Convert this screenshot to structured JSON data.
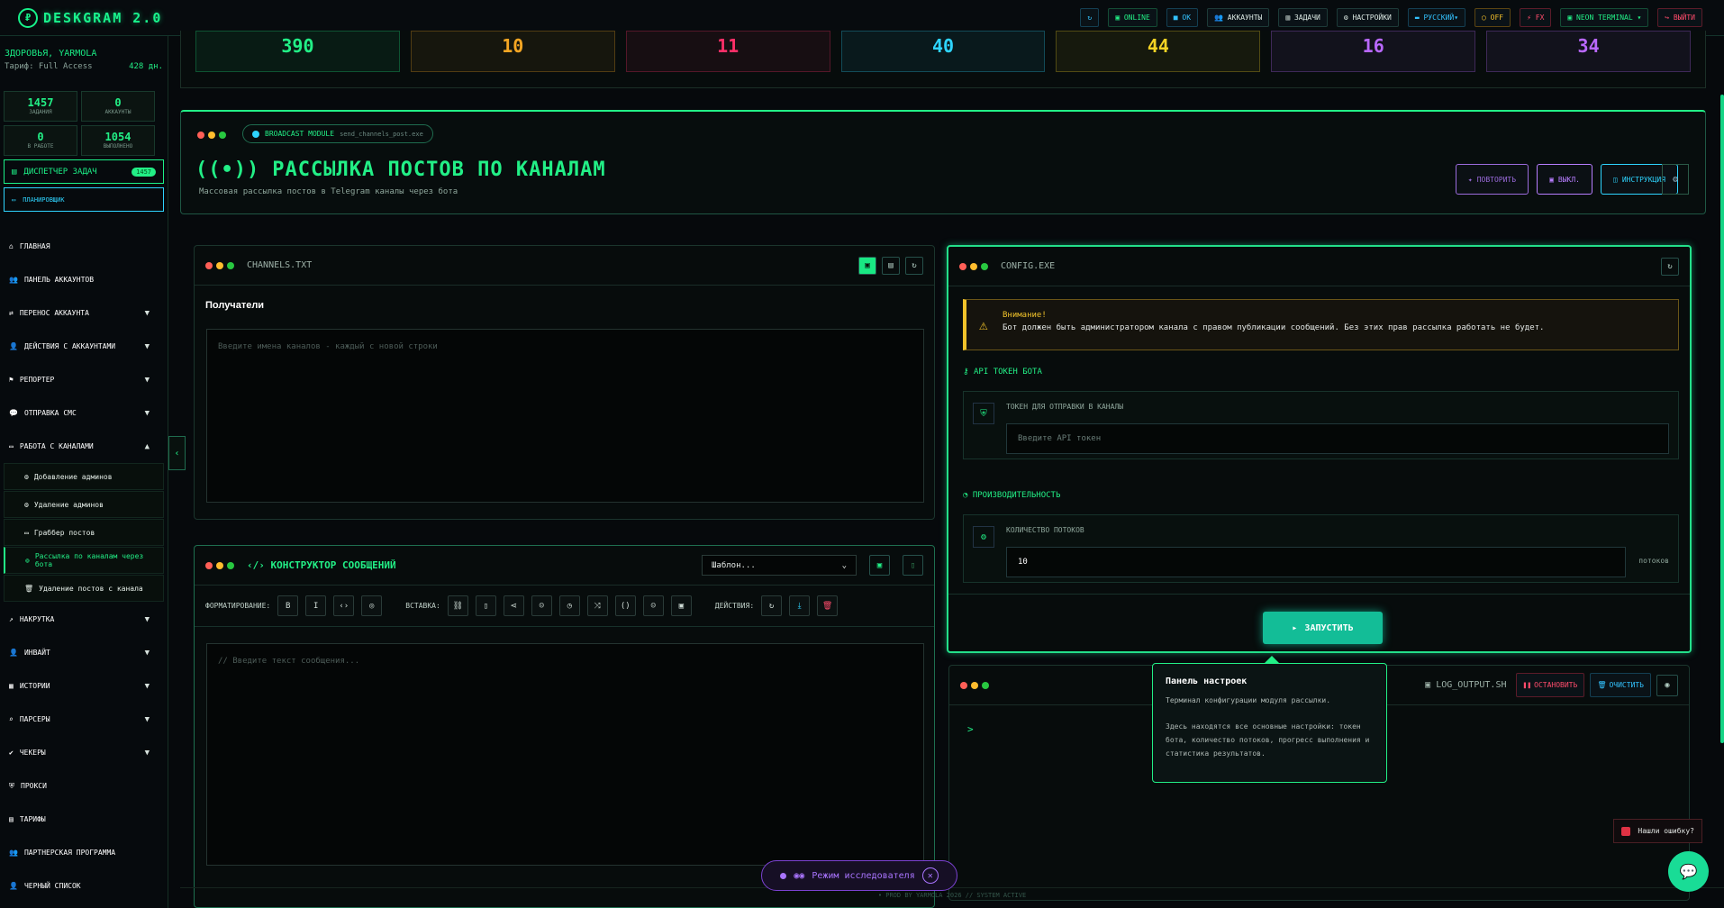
{
  "header": {
    "logo_badge": "₽",
    "title": "DESKGRAM 2.0",
    "buttons": [
      {
        "label": "↻",
        "color": "b"
      },
      {
        "label": "▣ ONLINE",
        "color": "g"
      },
      {
        "label": "■ OK",
        "color": "b"
      },
      {
        "label": "👥 АККАУНТЫ"
      },
      {
        "label": "▥ ЗАДАЧИ"
      },
      {
        "label": "⚙ НАСТРОЙКИ"
      },
      {
        "label": "▬ РУССКИЙ▾",
        "color": "b"
      },
      {
        "label": "◯ OFF",
        "color": "y"
      },
      {
        "label": "⚡ FX",
        "color": "r"
      },
      {
        "label": "▣ NEON TERMINAL ▾",
        "color": "g"
      },
      {
        "label": "↪ ВЫЙТИ",
        "color": "r"
      }
    ]
  },
  "sidebar": {
    "user": "ЗДОРОВЬЯ, YARMOLA",
    "plan": "Тариф: Full Access",
    "days": "428 дн.",
    "stats": [
      {
        "value": "1457",
        "label": "ЗАДАНИЯ"
      },
      {
        "value": "0",
        "label": "АККАУНТЫ"
      },
      {
        "value": "0",
        "label": "В РАБОТЕ"
      },
      {
        "value": "1054",
        "label": "ВЫПОЛНЕНО"
      }
    ],
    "dispatcher": "ДИСПЕТЧЕР ЗАДАЧ",
    "dispatcher_badge": "1457",
    "scheduler": "ПЛАНИРОВЩИК",
    "menu": [
      {
        "label": "ГЛАВНАЯ",
        "icon": "⌂"
      },
      {
        "label": "ПАНЕЛЬ АККАУНТОВ",
        "icon": "👥"
      },
      {
        "label": "ПЕРЕНОС АККАУНТА",
        "icon": "⇄",
        "ch": "▼"
      },
      {
        "label": "ДЕЙСТВИЯ С АККАУНТАМИ",
        "icon": "👤",
        "ch": "▼"
      },
      {
        "label": "РЕПОРТЕР",
        "icon": "⚑",
        "ch": "▼"
      },
      {
        "label": "ОТПРАВКА СМС",
        "icon": "💬",
        "ch": "▼"
      },
      {
        "label": "РАБОТА С КАНАЛАМИ",
        "icon": "▭",
        "ch": "▲"
      }
    ],
    "submenu": [
      {
        "label": "Добавление админов",
        "icon": "⚙"
      },
      {
        "label": "Удаление админов",
        "icon": "⚙"
      },
      {
        "label": "Граббер постов",
        "icon": "▭"
      },
      {
        "label": "Рассылка по каналам через бота",
        "icon": "⊚",
        "active": true
      },
      {
        "label": "Удаление постов с канала",
        "icon": "🗑"
      }
    ],
    "menu2": [
      {
        "label": "НАКРУТКА",
        "icon": "↗",
        "ch": "▼"
      },
      {
        "label": "ИНВАЙТ",
        "icon": "👤",
        "ch": "▼"
      },
      {
        "label": "ИСТОРИИ",
        "icon": "▦",
        "ch": "▼"
      },
      {
        "label": "ПАРСЕРЫ",
        "icon": "⌕",
        "ch": "▼"
      },
      {
        "label": "ЧЕКЕРЫ",
        "icon": "✔",
        "ch": "▼"
      },
      {
        "label": "ПРОКСИ",
        "icon": "⛨"
      },
      {
        "label": "ТАРИФЫ",
        "icon": "▤"
      },
      {
        "label": "ПАРТНЕРСКАЯ ПРОГРАММА",
        "icon": "👥"
      },
      {
        "label": "ЧЕРНЫЙ СПИСОК",
        "icon": "👤"
      }
    ]
  },
  "metrics": [
    {
      "value": "390",
      "color": "#22ef86"
    },
    {
      "value": "10",
      "color": "#f5a623"
    },
    {
      "value": "11",
      "color": "#ff2f68"
    },
    {
      "value": "40",
      "color": "#2ed4ff"
    },
    {
      "value": "44",
      "color": "#f4d324"
    },
    {
      "value": "16",
      "color": "#b968ff"
    },
    {
      "value": "34",
      "color": "#b968ff"
    }
  ],
  "hero": {
    "module": "BROADCAST MODULE",
    "file": "send_channels_post.exe",
    "title": "РАССЫЛКА ПОСТОВ ПО КАНАЛАМ",
    "subtitle": "Массовая рассылка постов в Telegram каналы через бота",
    "buttons": [
      {
        "label": "ПОВТОРИТЬ",
        "color": "#9b6bdc"
      },
      {
        "label": "ВЫКЛ.",
        "color": "#b77dff"
      },
      {
        "label": "ИНСТРУКЦИЯ",
        "color": "#2ed4ff"
      }
    ]
  },
  "channels": {
    "file": "CHANNELS.TXT",
    "label": "Получатели",
    "placeholder": "Введите имена каналов - каждый с новой строки"
  },
  "constructor": {
    "title": "КОНСТРУКТОР СООБЩЕНИЙ",
    "template": "Шаблон...",
    "format_label": "ФОРМАТИРОВАНИЕ:",
    "insert_label": "ВСТАВКА:",
    "actions_label": "ДЕЙСТВИЯ:",
    "placeholder": "// Введите текст сообщения..."
  },
  "config": {
    "file": "CONFIG.EXE",
    "warn_title": "Внимание!",
    "warn_text": "Бот должен быть администратором канала с правом публикации сообщений. Без этих прав рассылка работать не будет.",
    "token_section": "API ТОКЕН БОТА",
    "token_label": "ТОКЕН ДЛЯ ОТПРАВКИ В КАНАЛЫ",
    "token_placeholder": "Введите API токен",
    "perf_section": "ПРОИЗВОДИТЕЛЬНОСТЬ",
    "threads_label": "КОЛИЧЕСТВО ПОТОКОВ",
    "threads_value": "10",
    "threads_unit": "потоков",
    "run": "ЗАПУСТИТЬ"
  },
  "log": {
    "file": "LOG_OUTPUT.SH",
    "stop": "ОСТАНОВИТЬ",
    "clear": "ОЧИСТИТЬ",
    "prompt": ">"
  },
  "tooltip": {
    "title": "Панель настроек",
    "p1": "Терминал конфигурации модуля рассылки.",
    "p2": "Здесь находятся все основные настройки: токен бота, количество потоков, прогресс выполнения и статистика результатов."
  },
  "explore": "Режим исследователя",
  "bug": "Нашли ошибку?",
  "footer": "• PROD BY YARMOLA 2026   // SYSTEM ACTIVE"
}
